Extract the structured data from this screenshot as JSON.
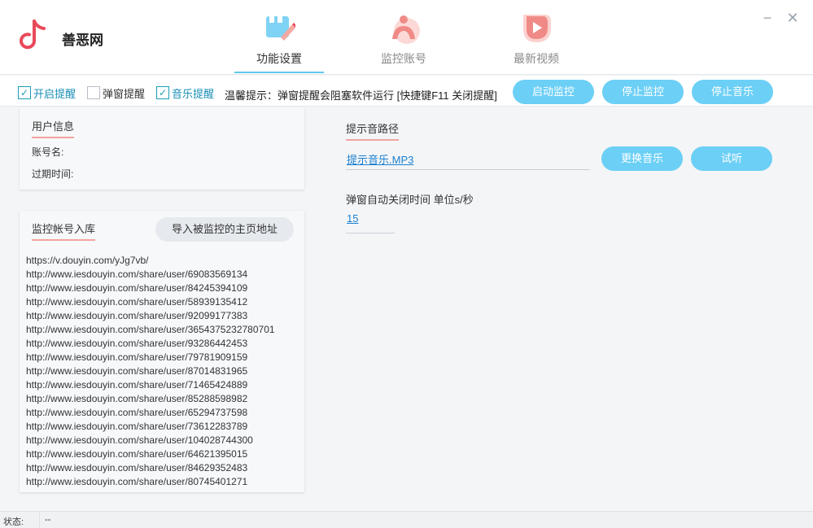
{
  "app": {
    "title": "善恶网",
    "logo_icon": "music-note-icon",
    "brand_color": "#e9495a"
  },
  "tabs": [
    {
      "label": "功能设置",
      "icon": "settings-edit-icon",
      "active": true
    },
    {
      "label": "监控账号",
      "icon": "user-account-icon",
      "active": false
    },
    {
      "label": "最新视频",
      "icon": "video-play-icon",
      "active": false
    }
  ],
  "window_controls": {
    "minimize": "−",
    "close": "✕"
  },
  "toolbar": {
    "checkboxes": [
      {
        "label": "开启提醒",
        "checked": true
      },
      {
        "label": "弹窗提醒",
        "checked": false
      },
      {
        "label": "音乐提醒",
        "checked": true
      }
    ],
    "tip": "温馨提示：弹窗提醒会阻塞软件运行 [快捷键F11 关闭提醒]",
    "buttons": {
      "start_monitor": "启动监控",
      "stop_monitor": "停止监控",
      "stop_music": "停止音乐"
    },
    "accent_color": "#6ccff6"
  },
  "user_info": {
    "title": "用户信息",
    "account_label": "账号名:",
    "expire_label": "过期时间:"
  },
  "monitor_import": {
    "title": "监控帐号入库",
    "import_button": "导入被监控的主页地址",
    "urls": [
      "https://v.douyin.com/yJg7vb/",
      "http://www.iesdouyin.com/share/user/69083569134",
      "http://www.iesdouyin.com/share/user/84245394109",
      "http://www.iesdouyin.com/share/user/58939135412",
      "http://www.iesdouyin.com/share/user/92099177383",
      "http://www.iesdouyin.com/share/user/3654375232780701",
      "http://www.iesdouyin.com/share/user/93286442453",
      "http://www.iesdouyin.com/share/user/79781909159",
      "http://www.iesdouyin.com/share/user/87014831965",
      "http://www.iesdouyin.com/share/user/71465424889",
      "http://www.iesdouyin.com/share/user/85288598982",
      "http://www.iesdouyin.com/share/user/65294737598",
      "http://www.iesdouyin.com/share/user/73612283789",
      "http://www.iesdouyin.com/share/user/104028744300",
      "http://www.iesdouyin.com/share/user/64621395015",
      "http://www.iesdouyin.com/share/user/84629352483",
      "http://www.iesdouyin.com/share/user/80745401271"
    ]
  },
  "sound": {
    "title": "提示音路径",
    "path": "提示音乐.MP3",
    "change_button": "更换音乐",
    "listen_button": "试听",
    "popup_close_label": "弹窗自动关闭时间 单位s/秒",
    "popup_close_value": "15"
  },
  "status": {
    "label": "状态:",
    "value": "--"
  }
}
